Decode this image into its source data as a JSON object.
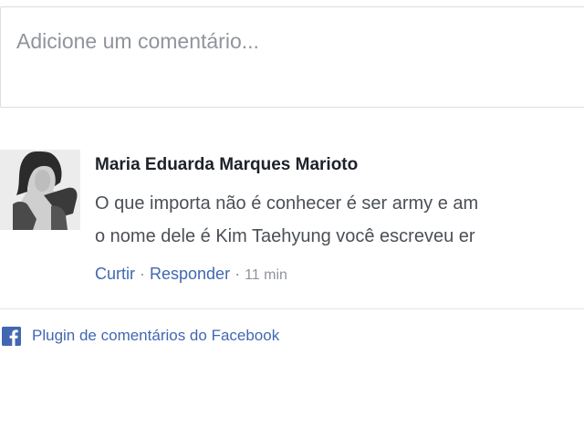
{
  "comment_box": {
    "placeholder": "Adicione um comentário..."
  },
  "comments": [
    {
      "author": "Maria Eduarda Marques Marioto",
      "text_line_1": "O que importa não é conhecer é ser army e am",
      "text_line_2": "o nome dele é Kim Taehyung você escreveu er",
      "actions": {
        "like_label": "Curtir",
        "reply_label": "Responder",
        "separator": "·",
        "time": "11 min"
      }
    }
  ],
  "footer": {
    "icon": "facebook-icon",
    "link_label": "Plugin de comentários do Facebook"
  },
  "colors": {
    "link": "#4267b2",
    "placeholder": "#90949c",
    "text": "#4b4f56",
    "author": "#1d2129"
  }
}
